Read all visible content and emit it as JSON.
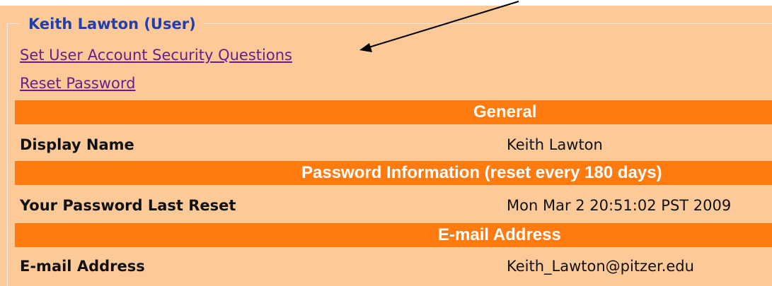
{
  "user": {
    "legend": "Keith Lawton (User)"
  },
  "links": {
    "security_questions": "Set User Account Security Questions",
    "reset_password": "Reset Password"
  },
  "sections": {
    "general": {
      "header": "General",
      "label": "Display Name",
      "value": "Keith Lawton"
    },
    "password": {
      "header": "Password Information (reset every 180 days)",
      "label": "Your Password Last Reset",
      "value": "Mon Mar 2 20:51:02 PST 2009"
    },
    "email": {
      "header": "E-mail Address",
      "label": "E-mail Address",
      "value": "Keith_Lawton@pitzer.edu"
    }
  },
  "colors": {
    "panel_background": "#fcc998",
    "header_bar": "#ff7b10",
    "legend_text": "#1f3fb0",
    "link_text": "#6b1c8f"
  },
  "icons": {
    "annotation": "arrow-icon"
  }
}
